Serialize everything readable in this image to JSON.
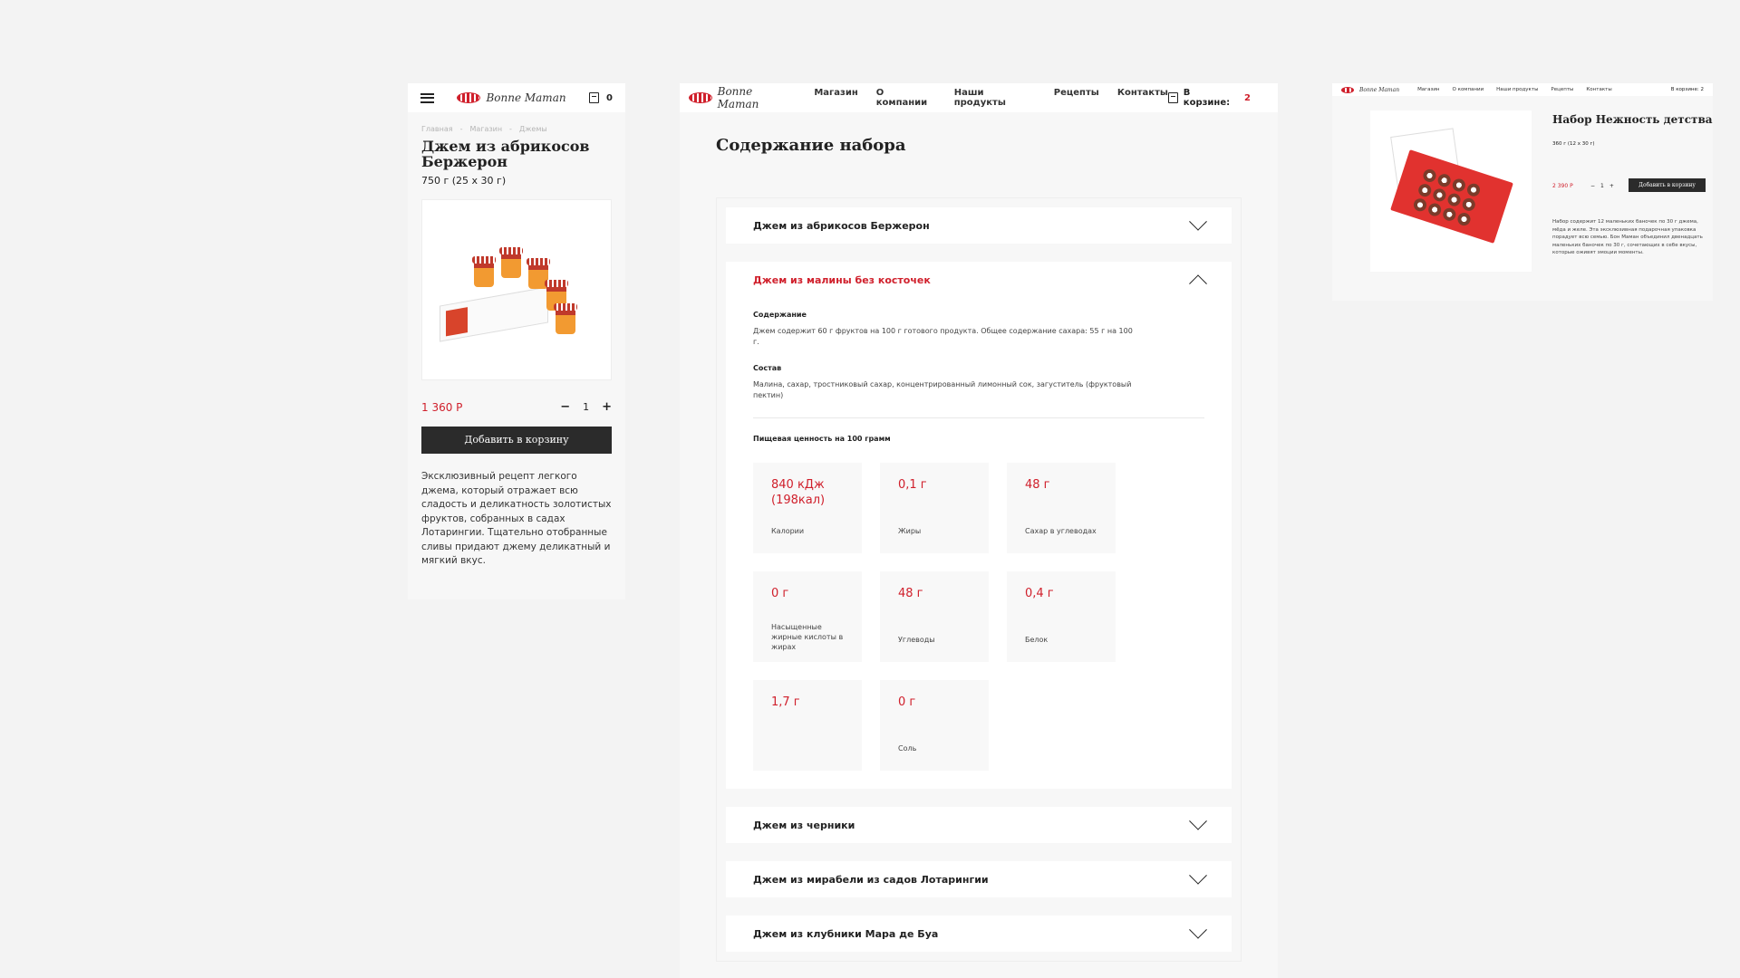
{
  "brand": {
    "logo_text": "Bonne Maman",
    "accent": "#d0202c"
  },
  "mobile": {
    "cart_count": "0",
    "breadcrumbs": [
      "Главная",
      "Магазин",
      "Джемы"
    ],
    "title": "Джем из абрикосов Бержерон",
    "weight": "750 г (25 x 30 г)",
    "price": "1 360 Р",
    "qty": "1",
    "minus": "−",
    "plus": "+",
    "add_button": "Добавить в корзину",
    "description": "Эксклюзивный рецепт легкого джема, который отражает всю сладость и деликатность золотистых фруктов, собранных в садах Лотарингии. Тщательно отобранные сливы придают джему деликатный и мягкий вкус."
  },
  "desktop": {
    "nav": [
      "Магазин",
      "О компании",
      "Наши продукты",
      "Рецепты",
      "Контакты"
    ],
    "cart_label": "В корзине:",
    "cart_count": "2",
    "title": "Содержание набора",
    "accordion": [
      {
        "title": "Джем из абрикосов Бержерон"
      },
      {
        "title": "Джем из малины без косточек",
        "content_label": "Содержание",
        "content_text": "Джем содержит 60 г фруктов на 100 г готового продукта. Общее содержание сахара: 55 г на 100 г.",
        "composition_label": "Состав",
        "composition_text": "Малина, сахар, тростниковый сахар, концентрированный лимонный сок, загуститель (фруктовый пектин)",
        "nutrition_label": "Пищевая ценность на 100 грамм",
        "nutrition": [
          {
            "value": "840 кДж (198кал)",
            "label": "Калории"
          },
          {
            "value": "0,1 г",
            "label": "Жиры"
          },
          {
            "value": "48 г",
            "label": "Сахар в углеводах"
          },
          {
            "value": "0 г",
            "label": "Насыщенные жирные кислоты в жирах"
          },
          {
            "value": "48 г",
            "label": "Углеводы"
          },
          {
            "value": "0,4 г",
            "label": "Белок"
          },
          {
            "value": "1,7 г",
            "label": ""
          },
          {
            "value": "0 г",
            "label": "Соль"
          }
        ]
      },
      {
        "title": "Джем из черники"
      },
      {
        "title": "Джем из мирабели из садов Лотарингии"
      },
      {
        "title": "Джем из клубники Мара де Буа"
      }
    ]
  },
  "thumb": {
    "nav": [
      "Магазин",
      "О компании",
      "Наши продукты",
      "Рецепты",
      "Контакты"
    ],
    "cart": "В корзине: 2",
    "title": "Набор Нежность детства",
    "weight": "360 г (12 x 30 г)",
    "price": "2 390 Р",
    "qty": "1",
    "minus": "−",
    "plus": "+",
    "add_button": "Добавить в корзину",
    "description": "Набор содержит 12 маленьких баночек по 30 г джема, мёда и желе. Эта эксклюзивная подарочная упаковка порадует всю семью. Бон Маман объединил двенадцать маленьких баночек по 30 г, сочетающих в себе вкусы, которые оживят эмоции моменты."
  }
}
